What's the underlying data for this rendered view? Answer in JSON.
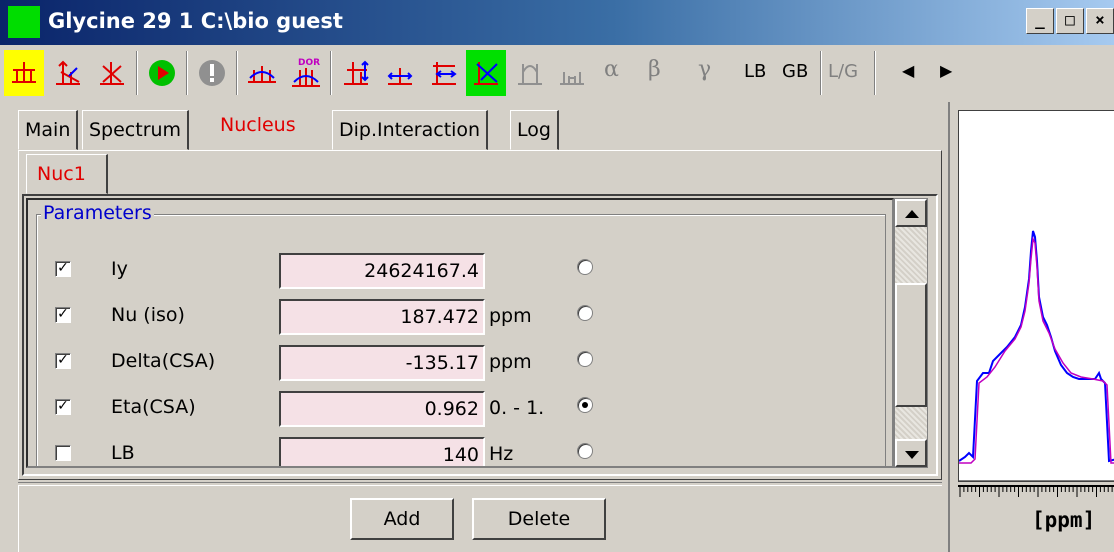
{
  "window": {
    "title": "Glycine 29  1  C:\\bio  guest",
    "controls": {
      "minimize": "_",
      "maximize": "□",
      "close": "×"
    }
  },
  "toolbar": {
    "greek": [
      "α",
      "β",
      "γ"
    ],
    "text_buttons": [
      "LB",
      "GB",
      "L/G"
    ],
    "nav_left": "◀",
    "nav_right": "▶",
    "icons": [
      "spectrum-yellow-icon",
      "spectrum-arrow-icon",
      "spectrum-cross-icon",
      "run-icon",
      "stop-icon",
      "multi-spectrum-icon",
      "dor-icon",
      "vertical-scale-icon",
      "horizontal-scale-icon",
      "expand-icon",
      "fit-icon",
      "iterate-icon",
      "multiplet-icon"
    ],
    "dor_label": "DOR"
  },
  "tabs": [
    "Main",
    "Spectrum",
    "Nucleus",
    "Dip.Interaction",
    "Log"
  ],
  "active_tab": "Nucleus",
  "subtabs": [
    "Nuc1"
  ],
  "group_title": "Parameters",
  "params": [
    {
      "checked": true,
      "label": "Iy",
      "value": "24624167.4",
      "unit": "",
      "selected": false
    },
    {
      "checked": true,
      "label": "Nu (iso)",
      "value": "187.472",
      "unit": "ppm",
      "selected": false
    },
    {
      "checked": true,
      "label": "Delta(CSA)",
      "value": "-135.17",
      "unit": "ppm",
      "selected": false
    },
    {
      "checked": true,
      "label": "Eta(CSA)",
      "value": "0.962",
      "unit": "0. - 1.",
      "selected": true
    },
    {
      "checked": false,
      "label": "LB",
      "value": "140",
      "unit": "Hz",
      "selected": false
    }
  ],
  "buttons": {
    "add": "Add",
    "delete": "Delete"
  },
  "spectrum": {
    "axis_label": "[ppm]",
    "exp_color": "#0000ff",
    "sim_color": "#c000c0"
  },
  "colors": {
    "accent_red": "#e00000",
    "group_blue": "#0000cc",
    "field_bg": "#f5e1e6"
  }
}
